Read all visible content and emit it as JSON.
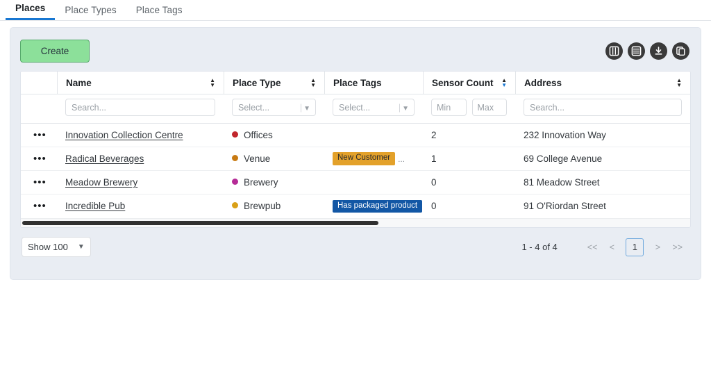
{
  "tabs": [
    {
      "label": "Places",
      "active": true
    },
    {
      "label": "Place Types",
      "active": false
    },
    {
      "label": "Place Tags",
      "active": false
    }
  ],
  "toolbar": {
    "create_label": "Create",
    "icons": [
      {
        "name": "columns-icon"
      },
      {
        "name": "rows-density-icon"
      },
      {
        "name": "download-icon"
      },
      {
        "name": "copy-icon"
      }
    ]
  },
  "table": {
    "columns": [
      {
        "key": "menu",
        "label": "",
        "sortable": false,
        "sort_active": false
      },
      {
        "key": "name",
        "label": "Name",
        "sortable": true,
        "sort_active": false
      },
      {
        "key": "type",
        "label": "Place Type",
        "sortable": true,
        "sort_active": false
      },
      {
        "key": "tags",
        "label": "Place Tags",
        "sortable": false,
        "sort_active": false
      },
      {
        "key": "sensor",
        "label": "Sensor Count",
        "sortable": true,
        "sort_active": true
      },
      {
        "key": "addr",
        "label": "Address",
        "sortable": true,
        "sort_active": false
      }
    ],
    "filters": {
      "name_placeholder": "Search...",
      "type_placeholder": "Select...",
      "tags_placeholder": "Select...",
      "sensor_min_placeholder": "Min",
      "sensor_max_placeholder": "Max",
      "address_placeholder": "Search..."
    },
    "rows": [
      {
        "menu": "•••",
        "name": "Innovation Collection Centre",
        "place_type": "Offices",
        "place_type_color": "#c1272d",
        "tag_label": "",
        "tag_bg": "",
        "tag_fg": "",
        "tag_overflow": "",
        "sensor_count": "2",
        "address": "232 Innovation Way"
      },
      {
        "menu": "•••",
        "name": "Radical Beverages",
        "place_type": "Venue",
        "place_type_color": "#c87a12",
        "tag_label": "New Customer",
        "tag_bg": "#e3a12a",
        "tag_fg": "#2b2b2b",
        "tag_overflow": "...",
        "sensor_count": "1",
        "address": "69 College Avenue"
      },
      {
        "menu": "•••",
        "name": "Meadow Brewery",
        "place_type": "Brewery",
        "place_type_color": "#b52b96",
        "tag_label": "",
        "tag_bg": "",
        "tag_fg": "",
        "tag_overflow": "",
        "sensor_count": "0",
        "address": "81 Meadow Street"
      },
      {
        "menu": "•••",
        "name": "Incredible Pub",
        "place_type": "Brewpub",
        "place_type_color": "#d9a017",
        "tag_label": "Has packaged product",
        "tag_bg": "#1257a5",
        "tag_fg": "#ffffff",
        "tag_overflow": "",
        "sensor_count": "0",
        "address": "91 O'Riordan Street"
      }
    ]
  },
  "footer": {
    "page_size_label": "Show 100",
    "range_label": "1 - 4 of 4",
    "first_label": "<<",
    "prev_label": "<",
    "current_page": "1",
    "next_label": ">",
    "last_label": ">>"
  },
  "colors": {
    "accent_blue": "#1877d2",
    "create_green": "#8ce09a",
    "panel_bg": "#e9edf3",
    "scrollbar_thumb": "#303030"
  }
}
